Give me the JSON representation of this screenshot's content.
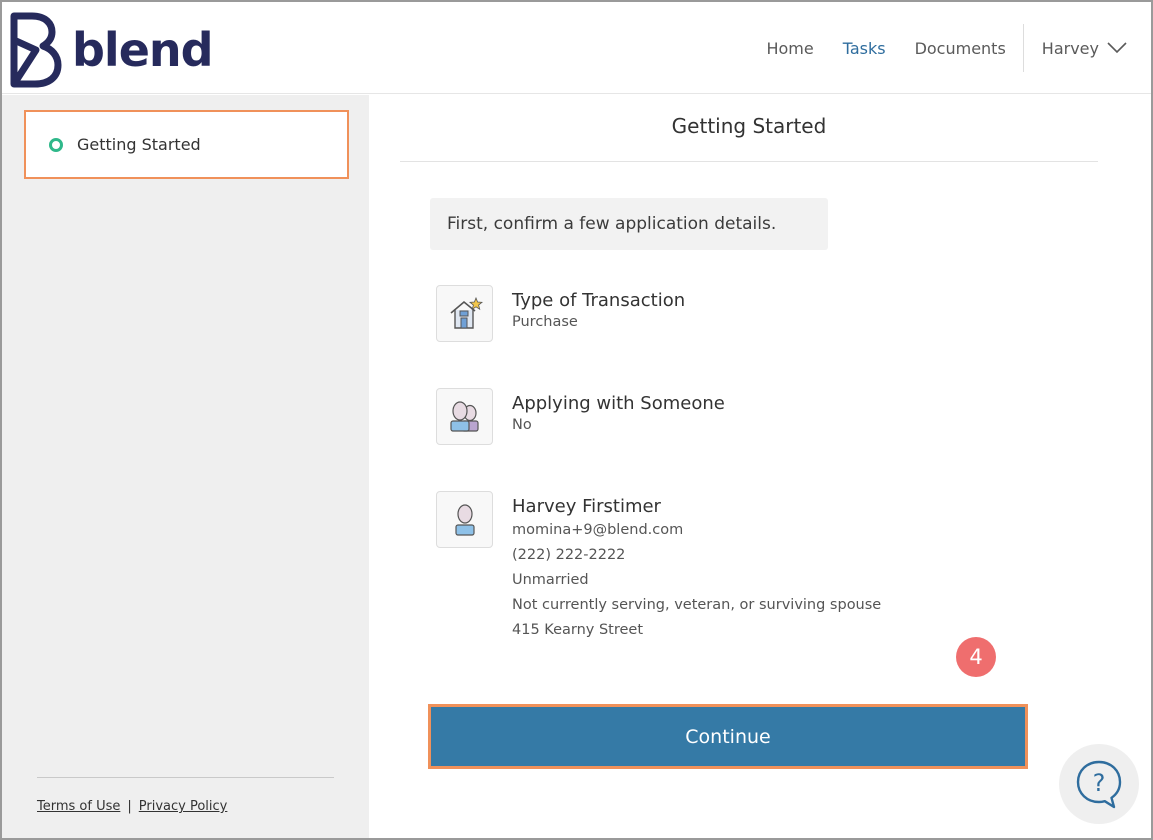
{
  "brand": {
    "name": "blend",
    "color": "#262a5c"
  },
  "nav": {
    "items": [
      {
        "label": "Home",
        "active": false
      },
      {
        "label": "Tasks",
        "active": true
      },
      {
        "label": "Documents",
        "active": false
      }
    ],
    "user": "Harvey"
  },
  "sidebar": {
    "items": [
      {
        "label": "Getting Started",
        "status": "in-progress"
      }
    ],
    "footer": {
      "terms": "Terms of Use",
      "separator": "|",
      "privacy": "Privacy Policy"
    }
  },
  "main": {
    "title": "Getting Started",
    "prompt": "First, confirm a few application details.",
    "details": [
      {
        "icon": "house-star-icon",
        "title": "Type of Transaction",
        "lines": [
          "Purchase"
        ]
      },
      {
        "icon": "two-people-icon",
        "title": "Applying with Someone",
        "lines": [
          "No"
        ]
      },
      {
        "icon": "person-icon",
        "title": "Harvey Firstimer",
        "lines": [
          "momina+9@blend.com",
          "(222) 222-2222",
          "Unmarried",
          "Not currently serving, veteran, or surviving spouse",
          "415 Kearny Street"
        ]
      }
    ],
    "step_badge": "4",
    "continue_label": "Continue"
  },
  "colors": {
    "accent": "#357aa6",
    "highlight": "#f0915a",
    "status": "#2fb88a",
    "badge": "#ef6e6e",
    "nav_active": "#2f6d9e"
  }
}
